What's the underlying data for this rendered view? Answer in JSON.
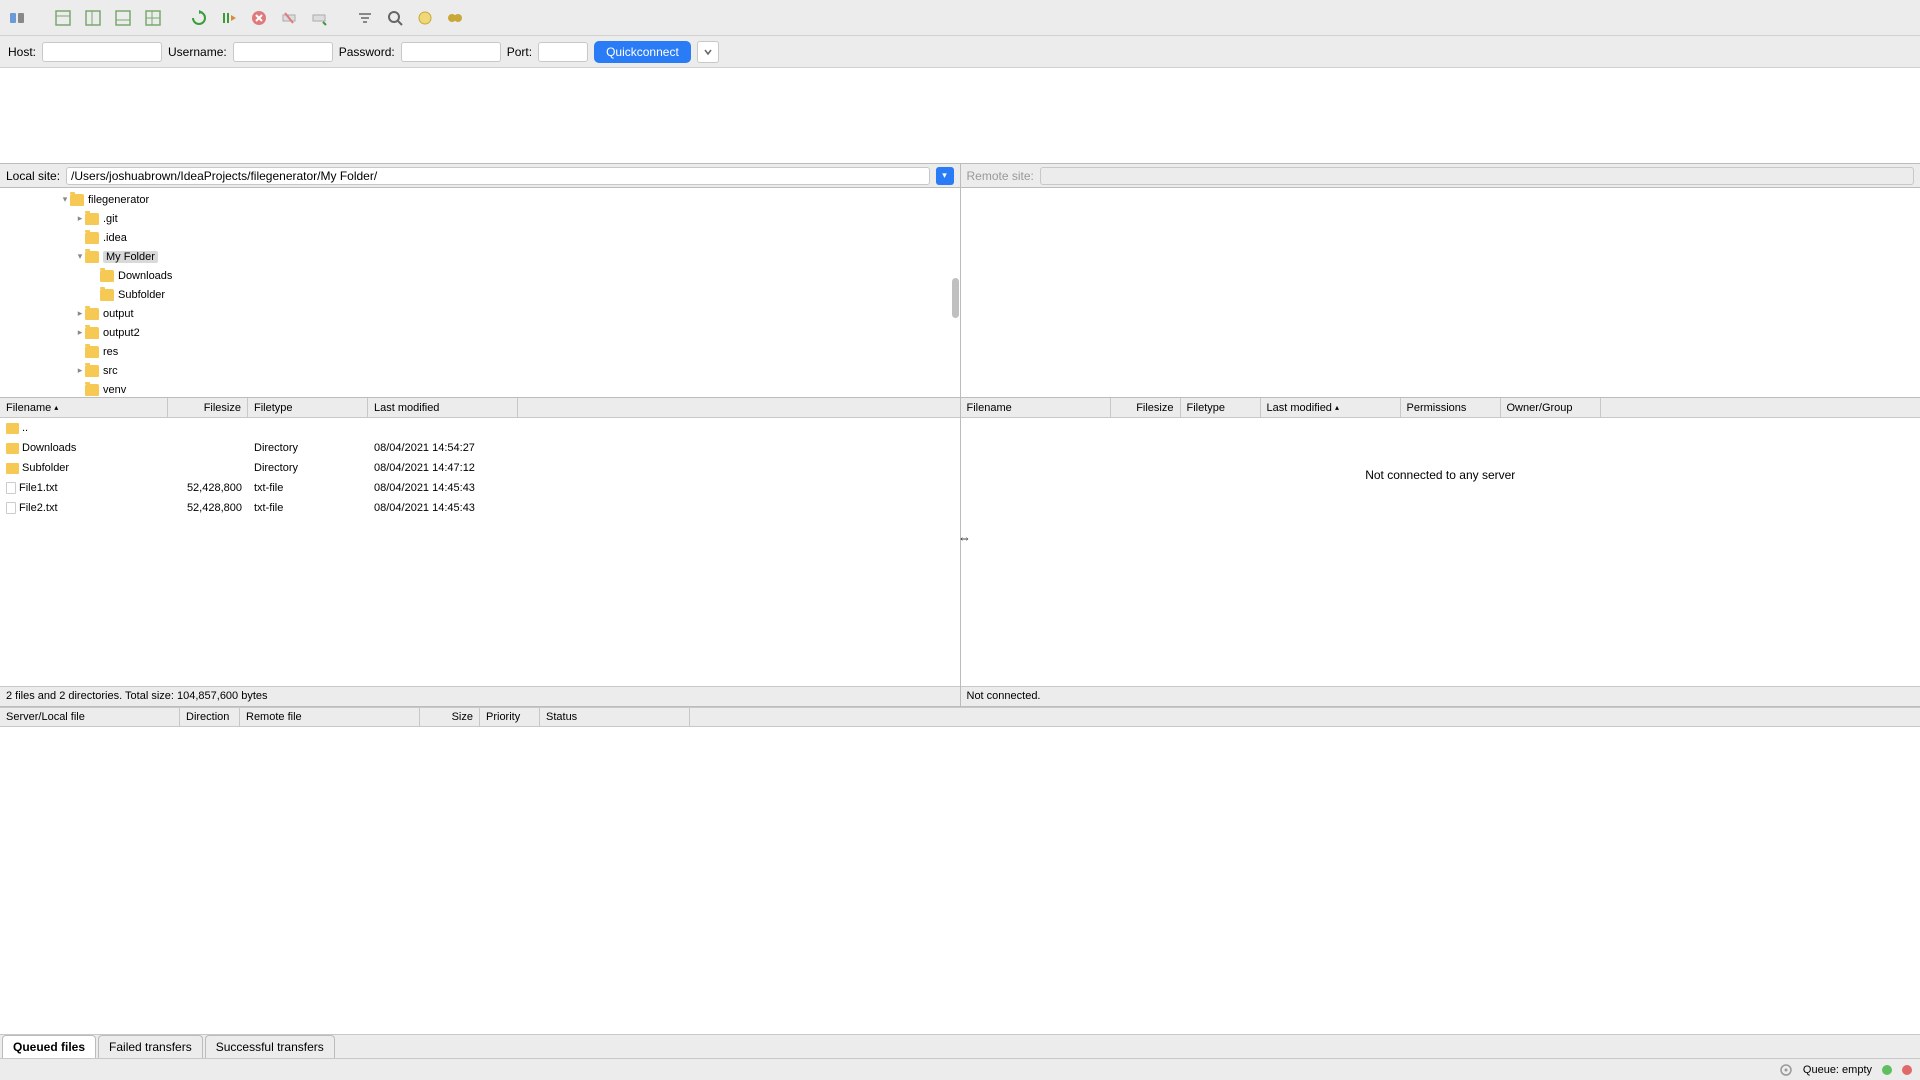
{
  "toolbar": {
    "icons": [
      "site-manager-icon",
      "toggle-log-icon",
      "toggle-tree-icon",
      "toggle-queue-icon",
      "refresh-icon",
      "process-queue-icon",
      "cancel-icon",
      "disconnect-icon",
      "reconnect-icon",
      "filter-icon",
      "search-icon",
      "compare-icon",
      "sync-browse-icon"
    ]
  },
  "quickconnect": {
    "host_label": "Host:",
    "username_label": "Username:",
    "password_label": "Password:",
    "port_label": "Port:",
    "button": "Quickconnect"
  },
  "local": {
    "site_label": "Local site:",
    "path": "/Users/joshuabrown/IdeaProjects/filegenerator/My Folder/",
    "tree": [
      {
        "indent": 60,
        "disclosure": "▾",
        "name": "filegenerator"
      },
      {
        "indent": 75,
        "disclosure": "▸",
        "name": ".git"
      },
      {
        "indent": 75,
        "disclosure": "",
        "name": ".idea"
      },
      {
        "indent": 75,
        "disclosure": "▾",
        "name": "My Folder",
        "selected": true
      },
      {
        "indent": 90,
        "disclosure": "",
        "name": "Downloads"
      },
      {
        "indent": 90,
        "disclosure": "",
        "name": "Subfolder"
      },
      {
        "indent": 75,
        "disclosure": "▸",
        "name": "output"
      },
      {
        "indent": 75,
        "disclosure": "▸",
        "name": "output2"
      },
      {
        "indent": 75,
        "disclosure": "",
        "name": "res"
      },
      {
        "indent": 75,
        "disclosure": "▸",
        "name": "src"
      },
      {
        "indent": 75,
        "disclosure": "",
        "name": "venv"
      }
    ],
    "columns": {
      "filename": "Filename",
      "filesize": "Filesize",
      "filetype": "Filetype",
      "modified": "Last modified"
    },
    "files": [
      {
        "icon": "folder",
        "name": "..",
        "size": "",
        "type": "",
        "modified": ""
      },
      {
        "icon": "folder",
        "name": "Downloads",
        "size": "",
        "type": "Directory",
        "modified": "08/04/2021 14:54:27"
      },
      {
        "icon": "folder",
        "name": "Subfolder",
        "size": "",
        "type": "Directory",
        "modified": "08/04/2021 14:47:12"
      },
      {
        "icon": "file",
        "name": "File1.txt",
        "size": "52,428,800",
        "type": "txt-file",
        "modified": "08/04/2021 14:45:43"
      },
      {
        "icon": "file",
        "name": "File2.txt",
        "size": "52,428,800",
        "type": "txt-file",
        "modified": "08/04/2021 14:45:43"
      }
    ],
    "status": "2 files and 2 directories. Total size: 104,857,600 bytes"
  },
  "remote": {
    "site_label": "Remote site:",
    "columns": {
      "filename": "Filename",
      "filesize": "Filesize",
      "filetype": "Filetype",
      "modified": "Last modified",
      "permissions": "Permissions",
      "owner": "Owner/Group"
    },
    "placeholder": "Not connected to any server",
    "status": "Not connected."
  },
  "transfer": {
    "columns": {
      "server": "Server/Local file",
      "direction": "Direction",
      "remote": "Remote file",
      "size": "Size",
      "priority": "Priority",
      "status": "Status"
    }
  },
  "tabs": {
    "queued": "Queued files",
    "failed": "Failed transfers",
    "success": "Successful transfers"
  },
  "statusbar": {
    "queue": "Queue: empty"
  }
}
